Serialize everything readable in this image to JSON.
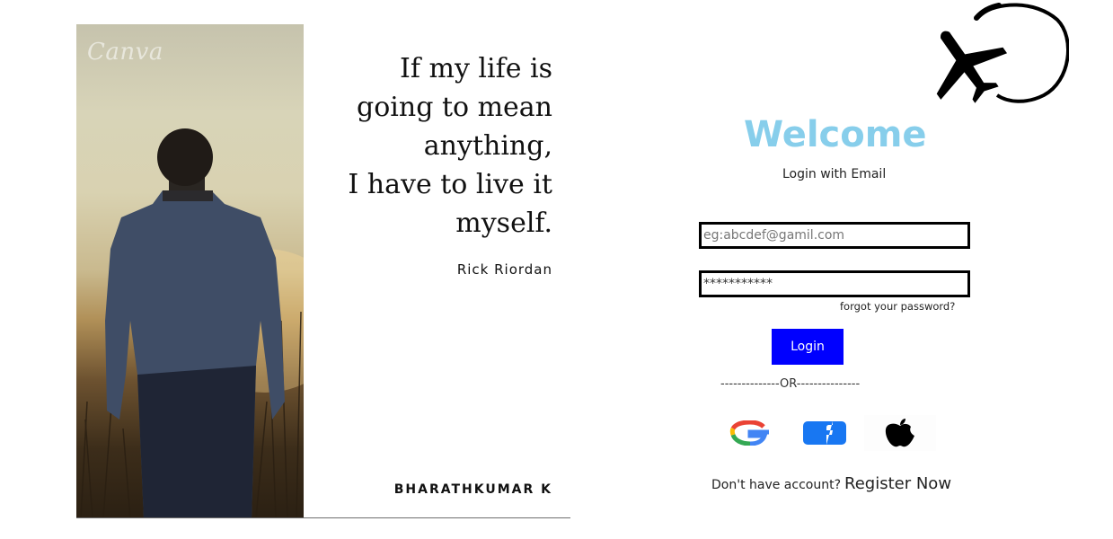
{
  "poster": {
    "watermark": "Canva",
    "quote_lines": [
      "If my life is",
      "going to mean",
      "anything,",
      "I have to live it",
      "myself."
    ],
    "quote_author": "Rick Riordan",
    "credit": "BHARATHKUMAR K"
  },
  "logo": {
    "icon": "airplane-circle-icon"
  },
  "login": {
    "title": "Welcome",
    "subtitle": "Login with Email",
    "email_placeholder": "eg:abcdef@gamil.com",
    "password_value": "***********",
    "forgot_label": "forgot your password?",
    "login_label": "Login",
    "or_divider": "--------------OR---------------",
    "social": [
      {
        "name": "Google",
        "icon": "google-icon"
      },
      {
        "name": "Facebook",
        "icon": "facebook-icon"
      },
      {
        "name": "Apple",
        "icon": "apple-icon"
      }
    ],
    "register_prompt": "Don't have account?",
    "register_link": "Register Now"
  },
  "colors": {
    "welcome": "#87ceeb",
    "login_button": "#0000ff",
    "facebook": "#1877f2"
  }
}
